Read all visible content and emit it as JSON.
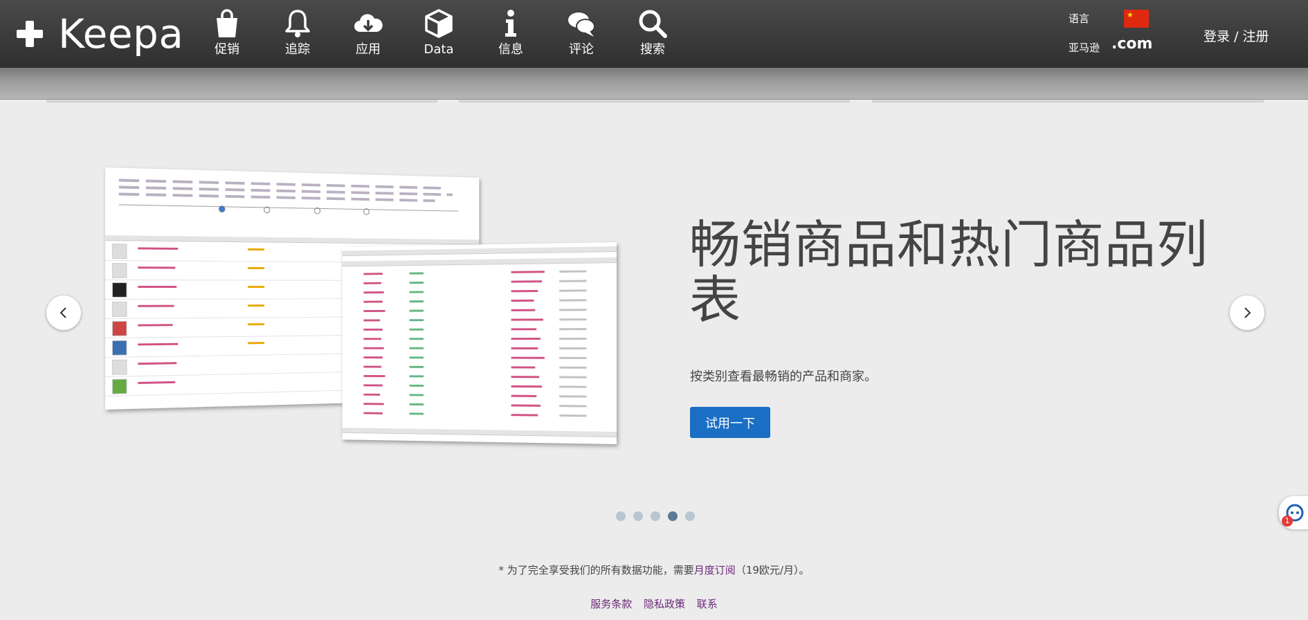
{
  "brand": {
    "name": "Keepa"
  },
  "nav": {
    "items": [
      {
        "label": "促销",
        "icon": "shopping-bag-icon"
      },
      {
        "label": "追踪",
        "icon": "bell-icon"
      },
      {
        "label": "应用",
        "icon": "cloud-download-icon"
      },
      {
        "label": "Data",
        "icon": "cube-icon"
      },
      {
        "label": "信息",
        "icon": "info-icon"
      },
      {
        "label": "评论",
        "icon": "chat-bubble-icon"
      },
      {
        "label": "搜索",
        "icon": "search-icon"
      }
    ]
  },
  "header": {
    "language_label": "语言",
    "language_flag": "china-flag-icon",
    "market_label": "亚马逊",
    "market_domain": ".com",
    "login": "登录 / 注册"
  },
  "carousel": {
    "title": "畅销商品和热门商品列表",
    "description": "按类别查看最畅销的产品和商家。",
    "button": "试用一下",
    "slide_count": 5,
    "active_slide": 4
  },
  "footer": {
    "note_prefix": "* 为了完全享受我们的所有数据功能，需要",
    "note_link": "月度订阅",
    "note_suffix": "（19欧元/月）。",
    "links": [
      "服务条款",
      "隐私政策",
      "联系"
    ]
  },
  "colors": {
    "topbar": "#3b3b3b",
    "primary_button": "#1a6fc4",
    "link": "#6b2a78",
    "active_dot": "#5a7b98"
  }
}
